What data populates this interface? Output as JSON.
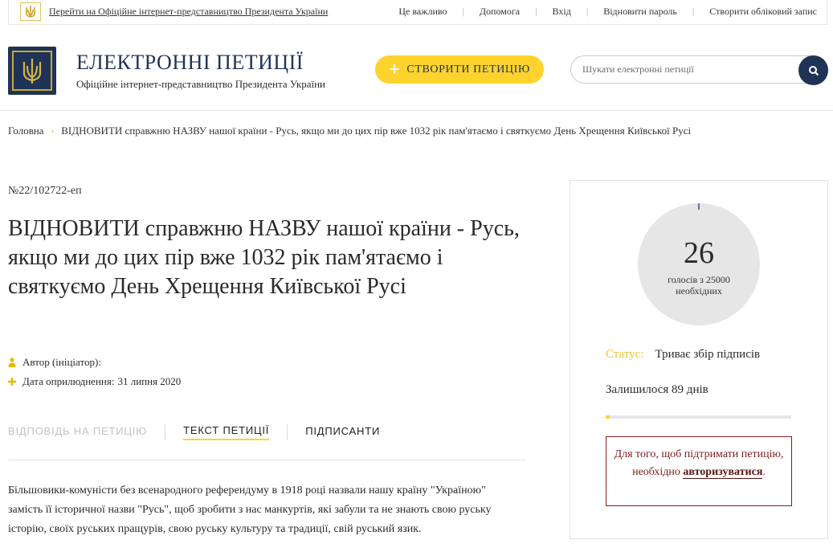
{
  "topbar": {
    "promo_text": "Перейти на Офіційне інтернет-представництво Президента України",
    "nav": [
      "Це важливо",
      "Допомога",
      "Вхід",
      "Відновити пароль",
      "Створити обліковий запис"
    ]
  },
  "header": {
    "title": "ЕЛЕКТРОННІ ПЕТИЦІЇ",
    "subtitle": "Офіційне інтернет-представництво Президента України",
    "create_button": "СТВОРИТИ ПЕТИЦІЮ",
    "search_placeholder": "Шукати електронні петиції"
  },
  "breadcrumb": {
    "home": "Головна",
    "current": "ВІДНОВИТИ справжню НАЗВУ нашої країни - Русь, якщо ми до цих пір вже 1032 рік пам'ятаємо і святкуємо День Хрещення Київської Русі"
  },
  "petition": {
    "number": "№22/102722-еп",
    "title": "ВІДНОВИТИ справжню НАЗВУ нашої країни - Русь, якщо ми до цих пір вже 1032 рік пам'ятаємо і святкуємо День Хрещення Київської Русі",
    "author_label": "Автор (ініціатор):",
    "date_label": "Дата оприлюднення:",
    "date_value": "31 липня 2020",
    "body": "Більшовики-комуністи без всенародного референдуму в 1918 році назвали нашу країну \"Україною\" замість її історичної назви \"Русь\", щоб зробити з нас манкуртів, які забули та не знають свою руську історію, своїх руських пращурів, свою руську культуру та традиції, свій руський язик."
  },
  "tabs": {
    "answer": "ВІДПОВІДЬ НА ПЕТИЦІЮ",
    "text": "ТЕКСТ ПЕТИЦІЇ",
    "signers": "ПІДПИСАНТИ"
  },
  "sidebar": {
    "votes": "26",
    "votes_caption": "голосів з 25000 необхідних",
    "votes_needed": 25000,
    "status_label": "Статус:",
    "status_value": "Триває збір підписів",
    "remaining": "Залишилося 89 днів",
    "progress_fraction": 0.00104,
    "auth_text": "Для того, щоб підтримати петицію, необхідно",
    "auth_link": "авторизуватися",
    "auth_tail": "."
  },
  "colors": {
    "navy": "#1f3357",
    "accent_yellow": "#ffd32e",
    "auth_border": "#8b1c1c"
  }
}
